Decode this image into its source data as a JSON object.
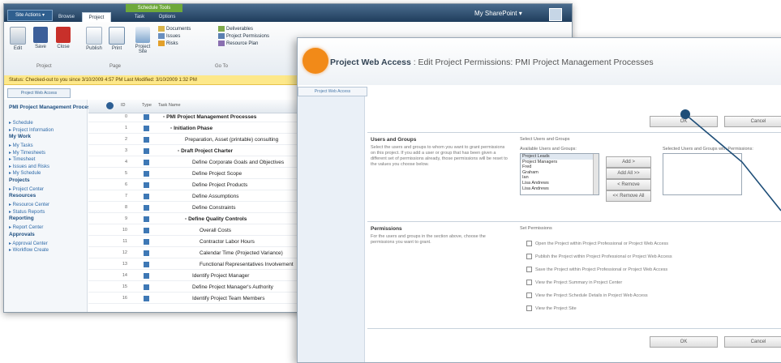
{
  "back_window": {
    "site_actions": "Site Actions ▾",
    "tabs": [
      "Browse",
      "Project",
      "Task",
      "Options"
    ],
    "contextual_tab_group": "Schedule Tools",
    "user_menu": "My SharePoint ▾",
    "ribbon": {
      "buttons": [
        "Edit",
        "Save",
        "Close",
        "Publish",
        "Print",
        "Project Site"
      ],
      "small_items": [
        "Documents",
        "Deliverables",
        "Issues",
        "Project Permissions",
        "Risks",
        "Resource Plan"
      ],
      "groups": [
        "Project",
        "Page",
        "Go To"
      ]
    },
    "status_bar": "Status: Checked-out to you since 3/10/2009 4:57 PM   Last Modified: 3/10/2009 1:32 PM",
    "pwa_tab": "Project Web Access",
    "left_nav": [
      {
        "text": "PMI Project Management Processes",
        "h": true
      },
      {
        "text": "▸ Schedule",
        "h": false
      },
      {
        "text": "▸ Project Information",
        "h": false
      },
      {
        "text": "My Work",
        "h": true
      },
      {
        "text": "▸ My Tasks",
        "h": false
      },
      {
        "text": "▸ My Timesheets",
        "h": false
      },
      {
        "text": "▸ Timesheet",
        "h": false
      },
      {
        "text": "▸ Issues and Risks",
        "h": false
      },
      {
        "text": "▸ My Schedule",
        "h": false
      },
      {
        "text": "Projects",
        "h": true
      },
      {
        "text": "▸ Project Center",
        "h": false
      },
      {
        "text": "Resources",
        "h": true
      },
      {
        "text": "▸ Resource Center",
        "h": false
      },
      {
        "text": "▸ Status Reports",
        "h": false
      },
      {
        "text": "Reporting",
        "h": true
      },
      {
        "text": "▸ Report Center",
        "h": false
      },
      {
        "text": "Approvals",
        "h": true
      },
      {
        "text": "▸ Approval Center",
        "h": false
      },
      {
        "text": "▸ Workflow Create",
        "h": false
      }
    ],
    "grid_headers": [
      "ID",
      "Type",
      "Task Name"
    ],
    "grid_rows": [
      {
        "id": "0",
        "name": "▫ PMI Project Management Processes",
        "indent": 0,
        "bold": true
      },
      {
        "id": "1",
        "name": "▫ Initiation Phase",
        "indent": 1,
        "bold": true
      },
      {
        "id": "2",
        "name": "Preparation, Asset (printable) consulting",
        "indent": 3,
        "bold": false
      },
      {
        "id": "3",
        "name": "▫ Draft Project Charter",
        "indent": 2,
        "bold": true
      },
      {
        "id": "4",
        "name": "Define Corporate Goals and Objectives",
        "indent": 4,
        "bold": false
      },
      {
        "id": "5",
        "name": "Define Project Scope",
        "indent": 4,
        "bold": false
      },
      {
        "id": "6",
        "name": "Define Project Products",
        "indent": 4,
        "bold": false
      },
      {
        "id": "7",
        "name": "Define Assumptions",
        "indent": 4,
        "bold": false
      },
      {
        "id": "8",
        "name": "Define Constraints",
        "indent": 4,
        "bold": false
      },
      {
        "id": "9",
        "name": "▫ Define Quality Controls",
        "indent": 3,
        "bold": true
      },
      {
        "id": "10",
        "name": "Overall Costs",
        "indent": 5,
        "bold": false
      },
      {
        "id": "11",
        "name": "Contractor Labor Hours",
        "indent": 5,
        "bold": false
      },
      {
        "id": "12",
        "name": "Calendar Time (Projected Variance)",
        "indent": 5,
        "bold": false
      },
      {
        "id": "13",
        "name": "Functional Representatives Involvement",
        "indent": 5,
        "bold": false
      },
      {
        "id": "14",
        "name": "Identify Project Manager",
        "indent": 4,
        "bold": false
      },
      {
        "id": "15",
        "name": "Define Project Manager's Authority",
        "indent": 4,
        "bold": false
      },
      {
        "id": "16",
        "name": "Identify Project Team Members",
        "indent": 4,
        "bold": false
      }
    ]
  },
  "front_window": {
    "title_bold": "Project Web Access",
    "title_rest": " : Edit Project Permissions: PMI Project Management Processes",
    "subtab": "Project Web Access",
    "buttons": {
      "ok_top": "OK",
      "cancel_top": "Cancel",
      "ok_bottom": "OK",
      "cancel_bottom": "Cancel"
    },
    "users_section": {
      "title": "Users and Groups",
      "description": "Select the users and groups to whom you want to grant permissions on this project. If you add a user or group that has been given a different set of permissions already, those permissions will be reset to the values you choose below.",
      "available_label": "Available Users and Groups:",
      "selected_label": "Selected Users and Groups with Permissions:",
      "list_label": "Select Users and Groups",
      "available_items": [
        "Project Leads",
        "Project Managers",
        "Fred",
        "Graham",
        "Ian",
        "Lisa Andrews",
        "Lisa Andrews"
      ],
      "add_button": "Add >",
      "add_all_button": "Add All >>",
      "remove_button": "< Remove",
      "remove_all_button": "<< Remove All"
    },
    "permissions_section": {
      "title": "Permissions",
      "description": "For the users and groups in the section above, choose the permissions you want to grant.",
      "list_label": "Set Permissions",
      "items": [
        "Open the Project within Project Professional or Project Web Access",
        "Publish the Project within Project Professional or Project Web Access",
        "Save the Project within Project Professional or Project Web Access",
        "View the Project Summary in Project Center",
        "View the Project Schedule Details in Project Web Access",
        "View the Project Site"
      ]
    }
  },
  "colors": {
    "accent_orange": "#f28a18",
    "title_blue": "#1f3d5c",
    "status_yellow": "#fde88a",
    "callout": "#1e4e78"
  }
}
